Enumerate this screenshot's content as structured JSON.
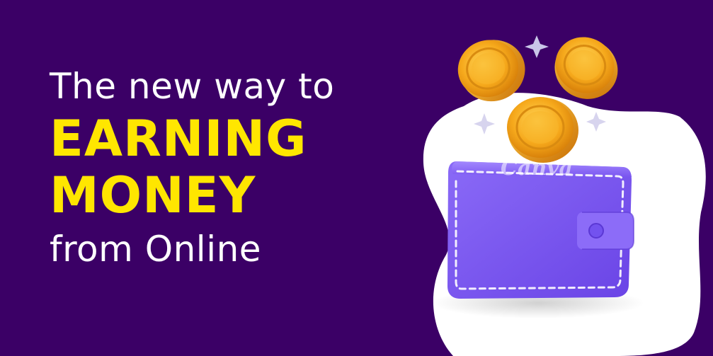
{
  "headline": {
    "line1": "The new way to",
    "line2": "EARNING",
    "line3": "MONEY",
    "line4": "from Online"
  },
  "watermark": "Canva",
  "colors": {
    "background": "#3b0066",
    "headline_light": "#ffffff",
    "headline_accent": "#ffe600",
    "blob": "#ffffff",
    "wallet": "#7a55f0",
    "coin": "#f5a623"
  },
  "icons": {
    "wallet": "wallet-icon",
    "coin": "coin-icon",
    "sparkle": "sparkle-icon"
  }
}
